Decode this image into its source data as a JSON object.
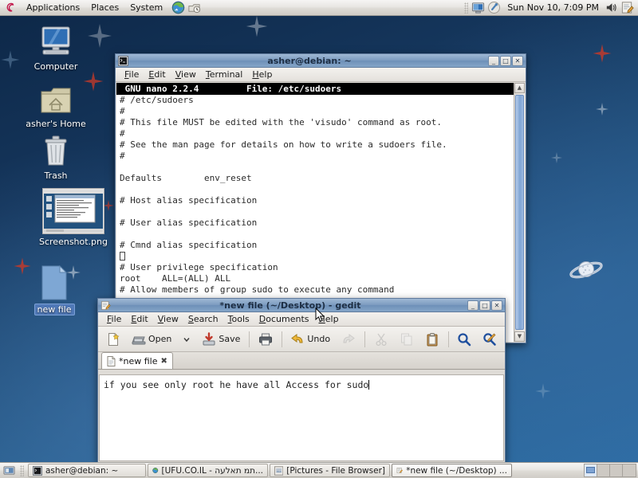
{
  "top_panel": {
    "logo_icon": "debian-swirl-icon",
    "menus": [
      "Applications",
      "Places",
      "System"
    ],
    "launchers": [
      {
        "name": "web-browser-icon"
      },
      {
        "name": "update-manager-icon"
      }
    ],
    "tray": [
      {
        "name": "display-settings-icon"
      },
      {
        "name": "brightness-applet-icon"
      },
      {
        "name": "volume-icon"
      },
      {
        "name": "text-editor-tray-icon"
      }
    ],
    "clock": "Sun Nov 10,  7:09 PM"
  },
  "desktop": {
    "icons": [
      {
        "label": "Computer",
        "icon": "computer-icon",
        "selected": false
      },
      {
        "label": "asher's Home",
        "icon": "home-folder-icon",
        "selected": false
      },
      {
        "label": "Trash",
        "icon": "trash-icon",
        "selected": false
      },
      {
        "label": "Screenshot.png",
        "icon": "screenshot-thumbnail-icon",
        "selected": false
      },
      {
        "label": "new file",
        "icon": "text-file-icon",
        "selected": true
      }
    ],
    "planet_icon": "saturn-planet-icon"
  },
  "terminal": {
    "title": "asher@debian: ~",
    "window_icon": "terminal-icon",
    "menus": [
      "File",
      "Edit",
      "View",
      "Terminal",
      "Help"
    ],
    "buttons": {
      "minimize": "_",
      "maximize": "□",
      "close": "✕"
    },
    "nano_header_left": "GNU nano 2.2.4",
    "nano_header_file": "File: /etc/sudoers",
    "lines": [
      "# /etc/sudoers",
      "#",
      "# This file MUST be edited with the 'visudo' command as root.",
      "#",
      "# See the man page for details on how to write a sudoers file.",
      "#",
      "",
      "Defaults        env_reset",
      "",
      "# Host alias specification",
      "",
      "# User alias specification",
      "",
      "# Cmnd alias specification",
      "",
      "# User privilege specification",
      "root    ALL=(ALL) ALL",
      "# Allow members of group sudo to execute any command"
    ],
    "cursor_line_index": 14
  },
  "gedit": {
    "title": "*new file (~/Desktop) - gedit",
    "window_icon": "gedit-icon",
    "menus": [
      "File",
      "Edit",
      "View",
      "Search",
      "Tools",
      "Documents",
      "Help"
    ],
    "buttons": {
      "minimize": "_",
      "maximize": "□",
      "close": "✕"
    },
    "toolbar": [
      {
        "name": "new-document-button",
        "label": "",
        "icon": "new-document-icon",
        "disabled": false
      },
      {
        "name": "open-button",
        "label": "Open",
        "icon": "open-folder-icon",
        "disabled": false
      },
      {
        "name": "open-dropdown-button",
        "label": "",
        "icon": "chevron-down-icon",
        "disabled": false
      },
      {
        "name": "save-button",
        "label": "Save",
        "icon": "save-icon",
        "disabled": false
      },
      {
        "name": "print-button",
        "label": "",
        "icon": "print-icon",
        "disabled": false
      },
      {
        "name": "undo-button",
        "label": "Undo",
        "icon": "undo-arrow-icon",
        "disabled": false
      },
      {
        "name": "redo-button",
        "label": "",
        "icon": "redo-arrow-icon",
        "disabled": true
      },
      {
        "name": "cut-button",
        "label": "",
        "icon": "scissors-icon",
        "disabled": true
      },
      {
        "name": "copy-button",
        "label": "",
        "icon": "copy-icon",
        "disabled": true
      },
      {
        "name": "paste-button",
        "label": "",
        "icon": "clipboard-paste-icon",
        "disabled": false
      },
      {
        "name": "find-button",
        "label": "",
        "icon": "magnifier-icon",
        "disabled": false
      },
      {
        "name": "replace-button",
        "label": "",
        "icon": "find-replace-icon",
        "disabled": false
      }
    ],
    "tab": {
      "label": "*new file",
      "icon": "document-icon",
      "close_icon": "close-icon"
    },
    "document_text": "if you see only root he have all Access for sudo"
  },
  "bottom_panel": {
    "show_desktop_icon": "show-desktop-icon",
    "tasks": [
      {
        "label": "asher@debian: ~",
        "icon": "terminal-icon",
        "active": false
      },
      {
        "label": "[UFU.CO.IL - תמ תאלעה...",
        "icon": "web-browser-icon",
        "active": false
      },
      {
        "label": "[Pictures - File Browser]",
        "icon": "file-manager-icon",
        "active": false
      },
      {
        "label": "*new file (~/Desktop) ...",
        "icon": "gedit-icon",
        "active": true
      }
    ],
    "workspaces": [
      {
        "current": true
      },
      {
        "current": false
      },
      {
        "current": false
      },
      {
        "current": false
      }
    ]
  },
  "colors": {
    "titlebar_active": "#7d9cc0",
    "desktop_top": "#0d2747",
    "desktop_bottom": "#2d6ea5",
    "selection_blue": "#5079b8",
    "star_red": "#b2222e"
  }
}
